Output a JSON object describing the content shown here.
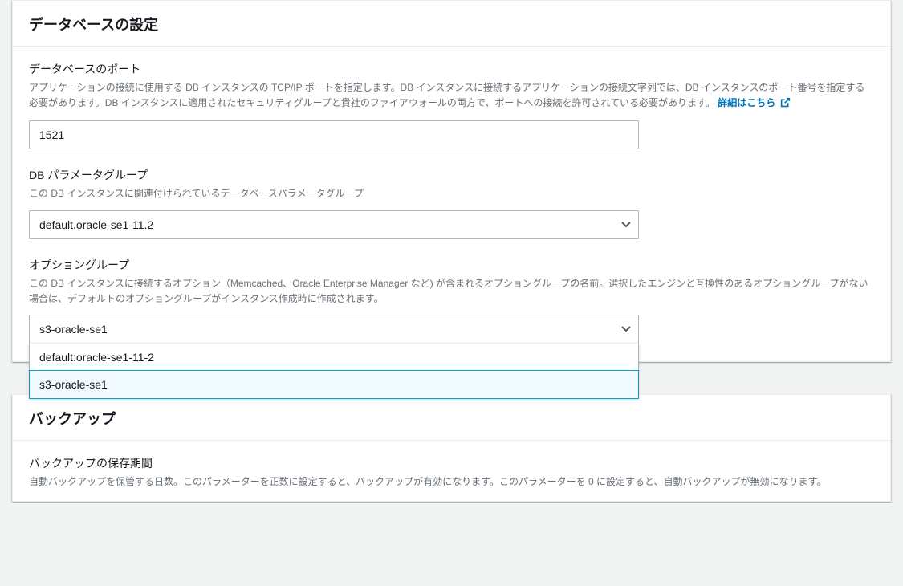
{
  "database_settings": {
    "header": "データベースの設定",
    "port": {
      "label": "データベースのポート",
      "description": "アプリケーションの接続に使用する DB インスタンスの TCP/IP ポートを指定します。DB インスタンスに接続するアプリケーションの接続文字列では、DB インスタンスのポート番号を指定する必要があります。DB インスタンスに適用されたセキュリティグループと貴社のファイアウォールの両方で、ポートへの接続を許可されている必要があります。",
      "learn_more": "詳細はこちら",
      "value": "1521"
    },
    "parameter_group": {
      "label": "DB パラメータグループ",
      "description": "この DB インスタンスに関連付けられているデータベースパラメータグループ",
      "value": "default.oracle-se1-11.2"
    },
    "option_group": {
      "label": "オプショングループ",
      "description": "この DB インスタンスに接続するオプション（Memcached、Oracle Enterprise Manager など) が含まれるオプショングループの名前。選択したエンジンと互換性のあるオプショングループがない場合は、デフォルトのオプショングループがインスタンス作成時に作成されます。",
      "value": "s3-oracle-se1",
      "options": [
        "default:oracle-se1-11-2",
        "s3-oracle-se1"
      ]
    }
  },
  "backup": {
    "header": "バックアップ",
    "retention": {
      "label": "バックアップの保存期間",
      "description": "自動バックアップを保管する日数。このパラメーターを正数に設定すると、バックアップが有効になります。このパラメーターを 0 に設定すると、自動バックアップが無効になります。"
    }
  }
}
